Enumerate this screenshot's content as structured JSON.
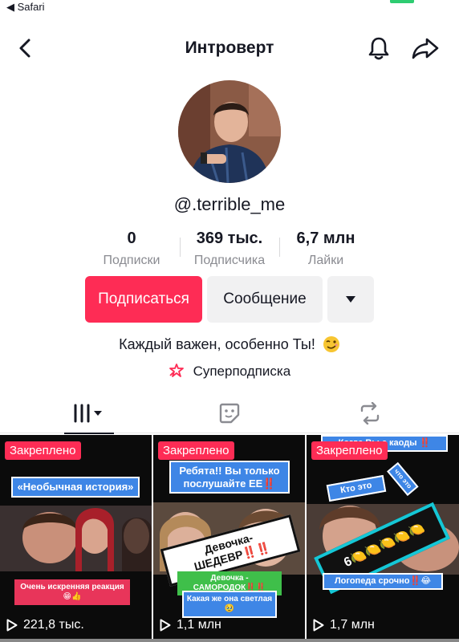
{
  "status_bar": {
    "back_app": "◀ Safari"
  },
  "header": {
    "title": "Интроверт"
  },
  "profile": {
    "username": "@.terrible_me",
    "stats": [
      {
        "value": "0",
        "label": "Подписки"
      },
      {
        "value": "369 тыс.",
        "label": "Подписчика"
      },
      {
        "value": "6,7 млн",
        "label": "Лайки"
      }
    ],
    "follow_label": "Подписаться",
    "message_label": "Сообщение",
    "bio": "Каждый важен, особенно Ты!",
    "bio_emoji": "winking-face-icon",
    "super_sub_label": "Суперподписка"
  },
  "tabs": [
    {
      "icon": "videos-grid-icon",
      "active": true
    },
    {
      "icon": "liked-sticker-icon",
      "active": false
    },
    {
      "icon": "repost-icon",
      "active": false
    }
  ],
  "videos": [
    {
      "pinned_label": "Закреплено",
      "views": "221,8 тыс.",
      "captions": [
        "«Необычная история»",
        "Очень искренняя реакция 😁👍"
      ]
    },
    {
      "pinned_label": "Закреплено",
      "views": "1,1 млн",
      "captions": [
        "Ребята!! Вы только послушайте ЕЕ‼️",
        "Девочка-ШЕДЕВР‼️‼️",
        "Девочка - САМОРОДОК‼️‼️",
        "Какая же она светлая 🥹"
      ]
    },
    {
      "pinned_label": "Закреплено",
      "views": "1,7 млн",
      "captions": [
        "Когда Вы с каоды ‼️",
        "Кто это",
        "что это",
        "6🍋🍋🍋🍋🍋",
        "Логопеда срочно‼️😂"
      ]
    }
  ],
  "colors": {
    "accent": "#fe2c55",
    "secondary_button": "#f1f1f2",
    "muted_text": "#8a8b91"
  }
}
